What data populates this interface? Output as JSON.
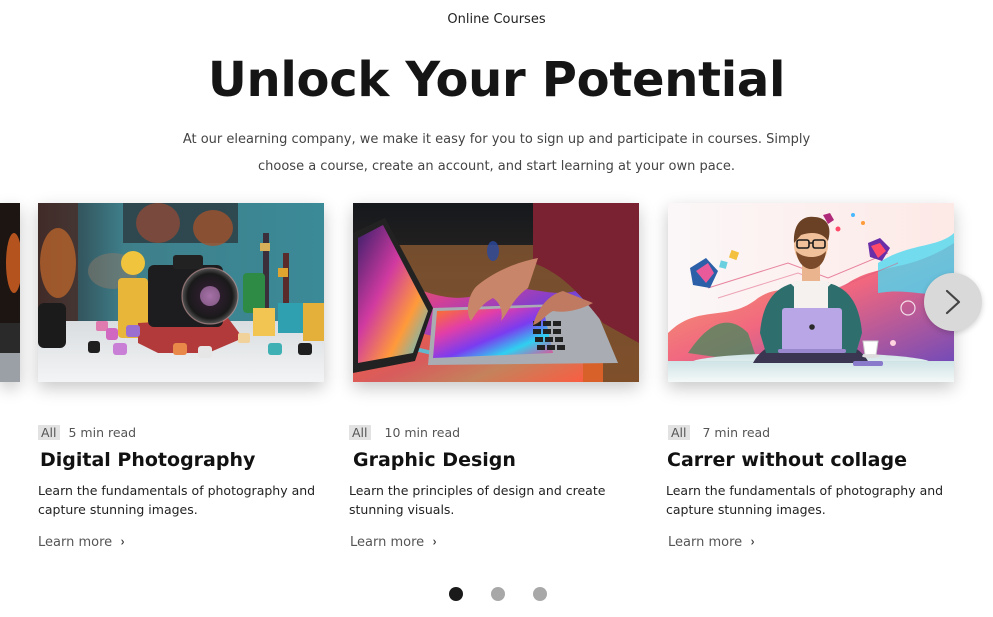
{
  "header": {
    "eyebrow": "Online Courses",
    "title": "Unlock Your Potential",
    "lead": "At our elearning company, we make it easy for you to sign up and participate in courses. Simply choose a course, create an account, and start learning at your own pace."
  },
  "courses": [
    {
      "image": "camera-on-desk-photo",
      "tag": "All",
      "read_time": "5 min read",
      "title": "Digital Photography",
      "description": "Learn the fundamentals of photography and capture stunning images.",
      "link": "Learn more"
    },
    {
      "image": "laptop-colorful-design-photo",
      "tag": "All",
      "read_time": "10 min read",
      "title": "Graphic Design",
      "description": "Learn the principles of design and create stunning visuals.",
      "link": "Learn more"
    },
    {
      "image": "man-with-laptop-illustration",
      "tag": "All",
      "read_time": "7 min read",
      "title": "Carrer without collage",
      "description": "Learn the fundamentals of photography and capture stunning images.",
      "link": "Learn more"
    }
  ],
  "carousel": {
    "next_icon": "chevron-right-icon",
    "link_icon": "›",
    "pages": 3,
    "active_page": 1
  },
  "colors": {
    "title": "#151515",
    "dot_active": "#1a1a1a",
    "dot_inactive": "#a8a8a8",
    "tag_bg": "#e2e2e2",
    "next_button_bg": "#d9d9d9"
  }
}
